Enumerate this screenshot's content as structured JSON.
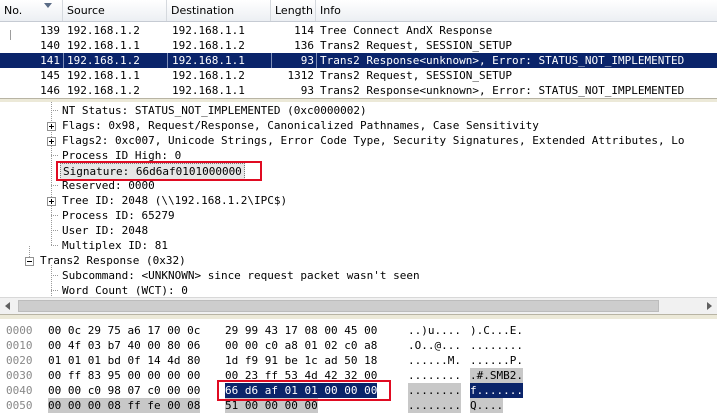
{
  "packet_list": {
    "columns": [
      "No.",
      "Source",
      "Destination",
      "Length",
      "Info"
    ],
    "rows": [
      {
        "no": "139",
        "src": "192.168.1.2",
        "dst": "192.168.1.1",
        "len": "114",
        "info": "Tree Connect AndX Response",
        "selected": false
      },
      {
        "no": "140",
        "src": "192.168.1.1",
        "dst": "192.168.1.2",
        "len": "136",
        "info": "Trans2 Request, SESSION_SETUP",
        "selected": false
      },
      {
        "no": "141",
        "src": "192.168.1.2",
        "dst": "192.168.1.1",
        "len": "93",
        "info": "Trans2 Response<unknown>, Error: STATUS_NOT_IMPLEMENTED",
        "selected": true
      },
      {
        "no": "145",
        "src": "192.168.1.1",
        "dst": "192.168.1.2",
        "len": "1312",
        "info": "Trans2 Request, SESSION_SETUP",
        "selected": false
      },
      {
        "no": "146",
        "src": "192.168.1.2",
        "dst": "192.168.1.1",
        "len": "93",
        "info": "Trans2 Response<unknown>, Error: STATUS_NOT_IMPLEMENTED",
        "selected": false
      }
    ]
  },
  "details": {
    "nt_status": "NT Status: STATUS_NOT_IMPLEMENTED (0xc0000002)",
    "flags": "Flags: 0x98, Request/Response, Canonicalized Pathnames, Case Sensitivity",
    "flags2": "Flags2: 0xc007, Unicode Strings, Error Code Type, Security Signatures, Extended Attributes, Lo",
    "pid_high": "Process ID High: 0",
    "signature": "Signature: 66d6af0101000000",
    "reserved": "Reserved: 0000",
    "tree_id": "Tree ID: 2048  (\\\\192.168.1.2\\IPC$)",
    "process_id": "Process ID: 65279",
    "user_id": "User ID: 2048",
    "multiplex_id": "Multiplex ID: 81",
    "trans2": "Trans2 Response (0x32)",
    "subcommand": "Subcommand: <UNKNOWN> since request packet wasn't seen",
    "word_count": "Word Count (WCT): 0"
  },
  "hex": {
    "rows": [
      {
        "offset": "0000",
        "b1": "00 0c 29 75 a6 17 00 0c",
        "b2": "29 99 43 17 08 00 45 00",
        "a1": "..)u....",
        "a2": ").C...E."
      },
      {
        "offset": "0010",
        "b1": "00 4f 03 b7 40 00 80 06",
        "b2": "00 00 c0 a8 01 02 c0 a8",
        "a1": ".O..@...",
        "a2": "........"
      },
      {
        "offset": "0020",
        "b1": "01 01 01 bd 0f 14 4d 80",
        "b2": "1d f9 91 be 1c ad 50 18",
        "a1": "......M.",
        "a2": "......P."
      },
      {
        "offset": "0030",
        "b1": "00 ff 83 95 00 00 00 00",
        "b2": "00 23 ff 53 4d 42 32 00",
        "a1": "........",
        "a2": ".#.SMB2."
      },
      {
        "offset": "0040",
        "b1": "00 00 c0 98 07 c0 00 00",
        "b2": "66 d6 af 01 01 00 00 00",
        "a1": "........",
        "a2": "f......."
      },
      {
        "offset": "0050",
        "b1": "00 00 00 08 ff fe 00 08",
        "b2": "51 00 00 00 00",
        "a1": "........",
        "a2": "Q...."
      }
    ]
  },
  "colors": {
    "selection": "#0a246a",
    "highlight_box": "#e00b22"
  }
}
